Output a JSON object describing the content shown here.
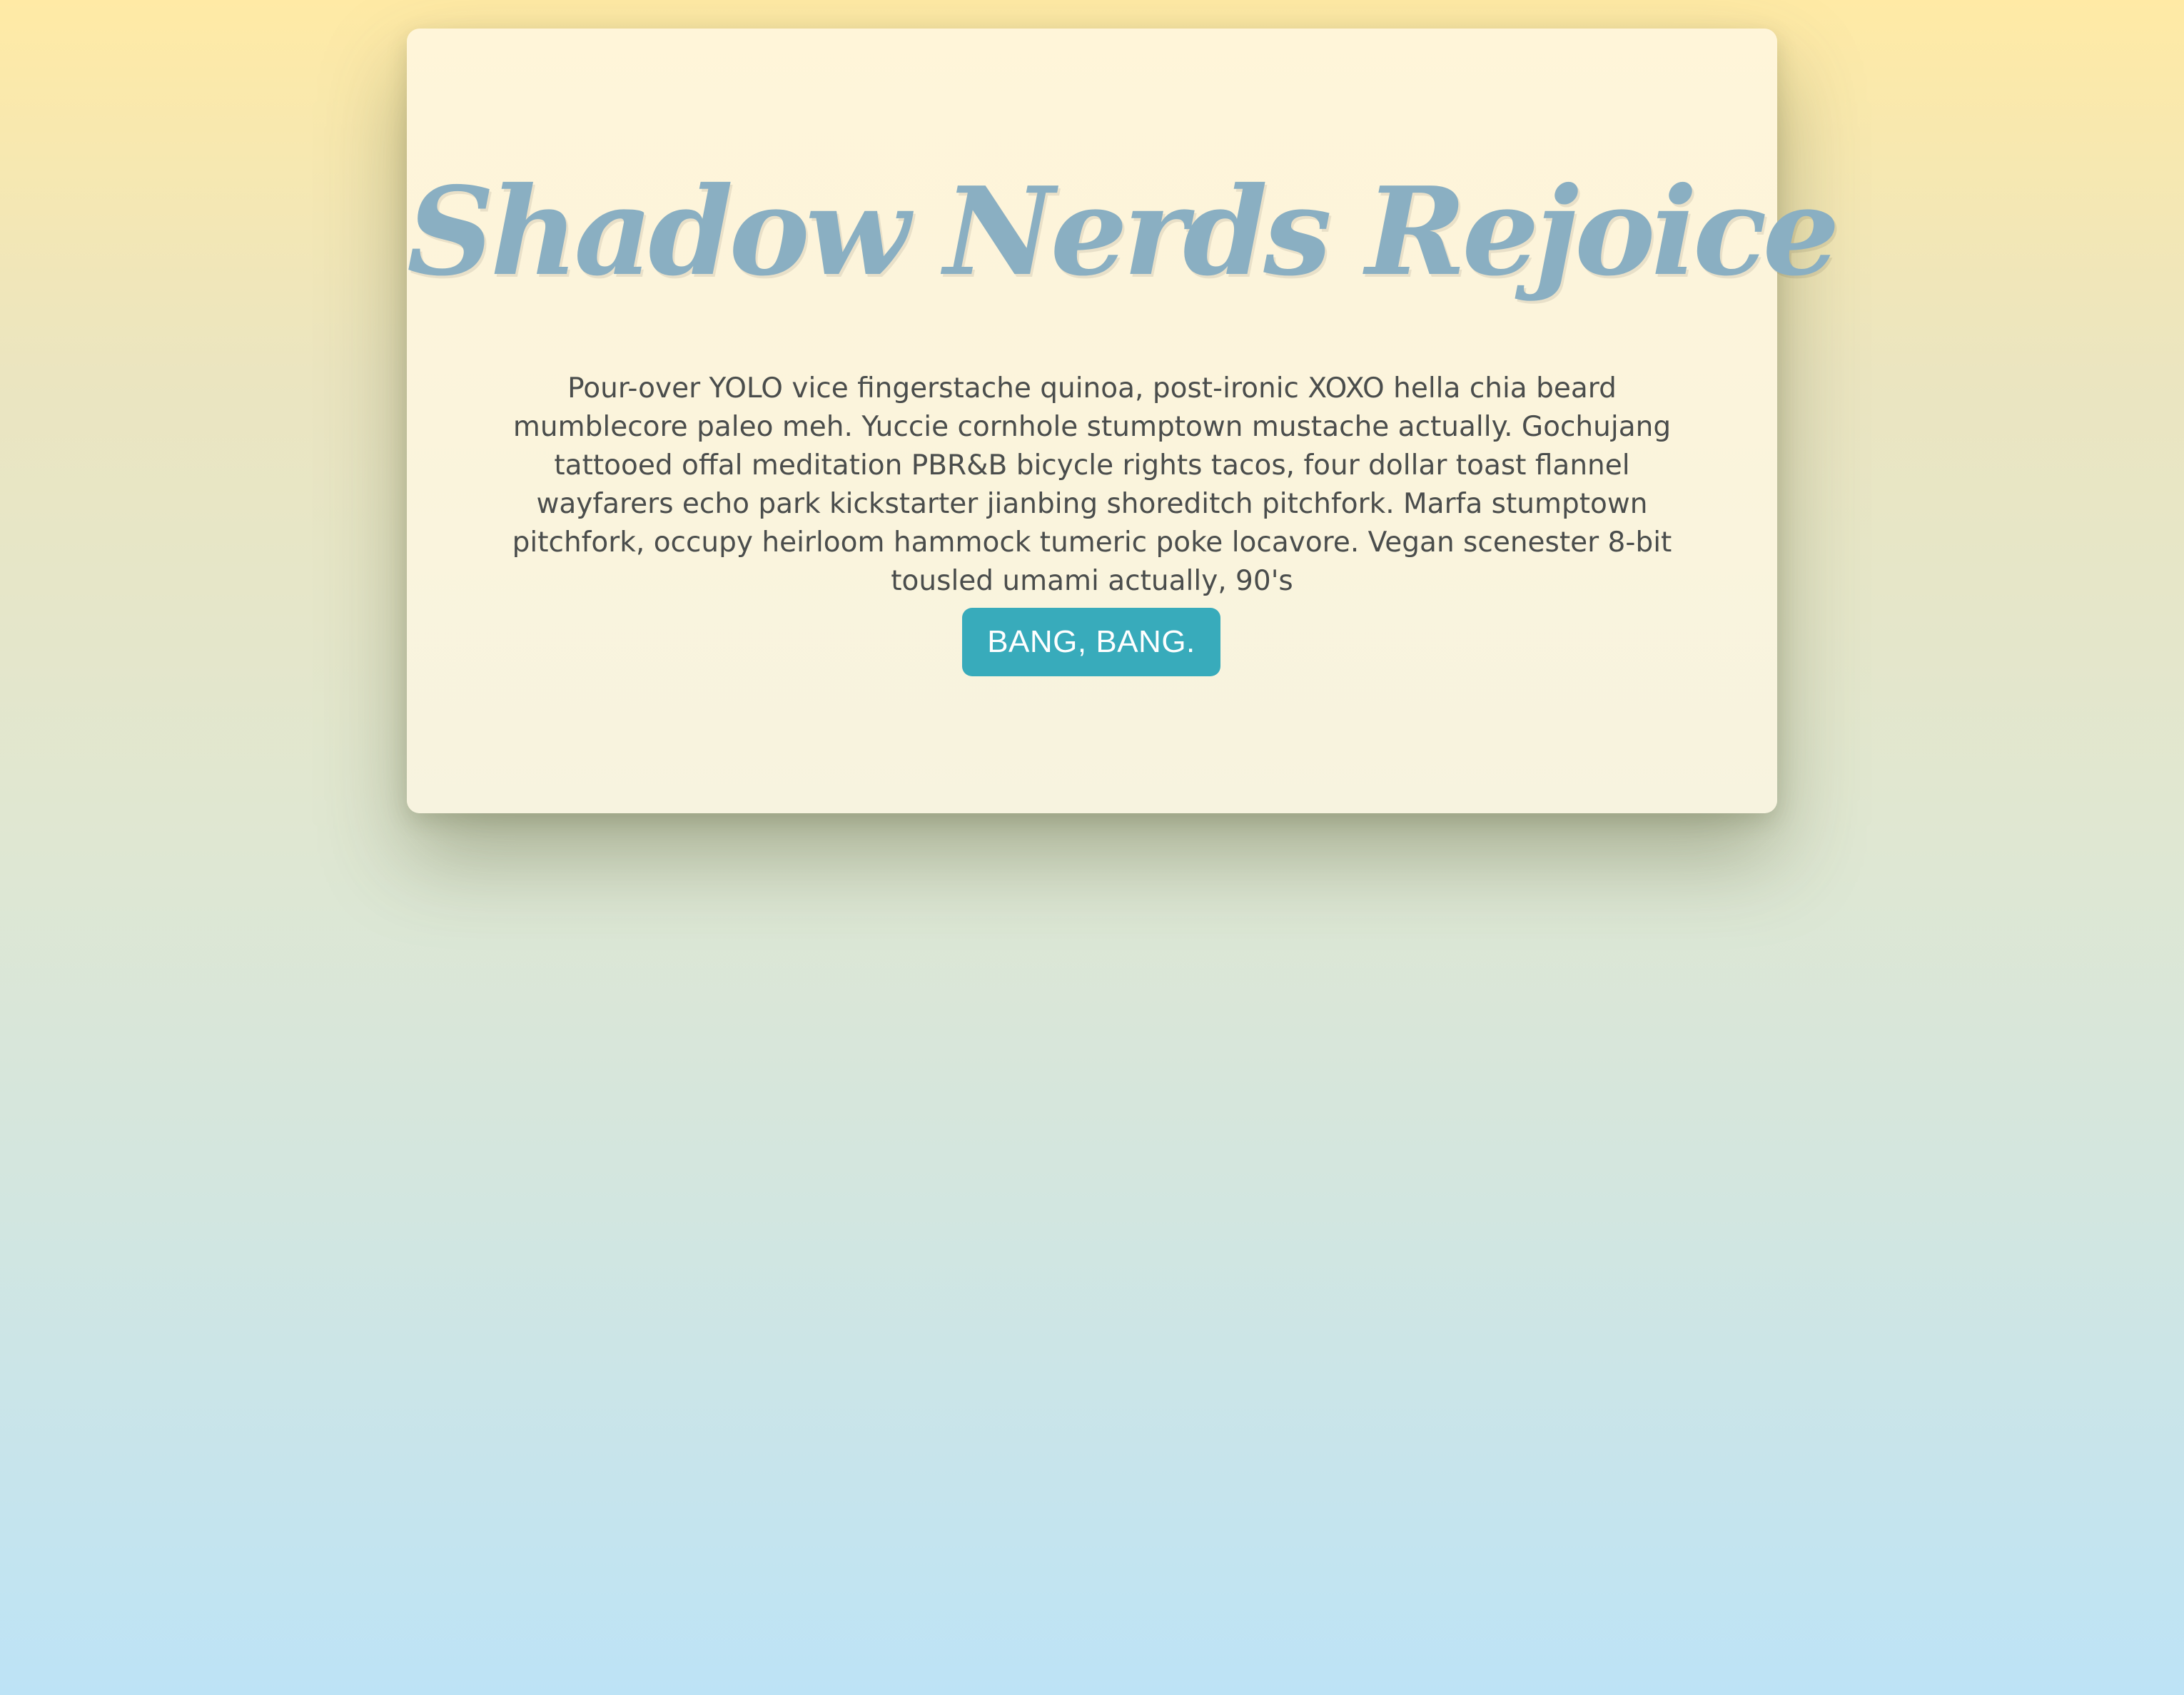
{
  "card": {
    "title": "Shadow Nerds Rejoice",
    "body": "Pour-over YOLO vice fingerstache quinoa, post-ironic XOXO hella chia beard mumblecore paleo meh. Yuccie cornhole stumptown mustache actually. Gochujang tattooed offal meditation PBR&B bicycle rights tacos, four dollar toast flannel wayfarers echo park kickstarter jianbing shoreditch pitchfork. Marfa stumptown pitchfork, occupy heirloom hammock tumeric poke locavore. Vegan scenester 8-bit tousled umami actually, 90's",
    "button_label": "BANG, BANG."
  },
  "colors": {
    "background_top": "#ffeaa5",
    "background_bottom": "#bde3f6",
    "card_background": "#fff5d9",
    "title_color": "#8aafc2",
    "body_text_color": "#4a4d4c",
    "button_background": "#38abbb",
    "button_text": "#ffffff"
  }
}
